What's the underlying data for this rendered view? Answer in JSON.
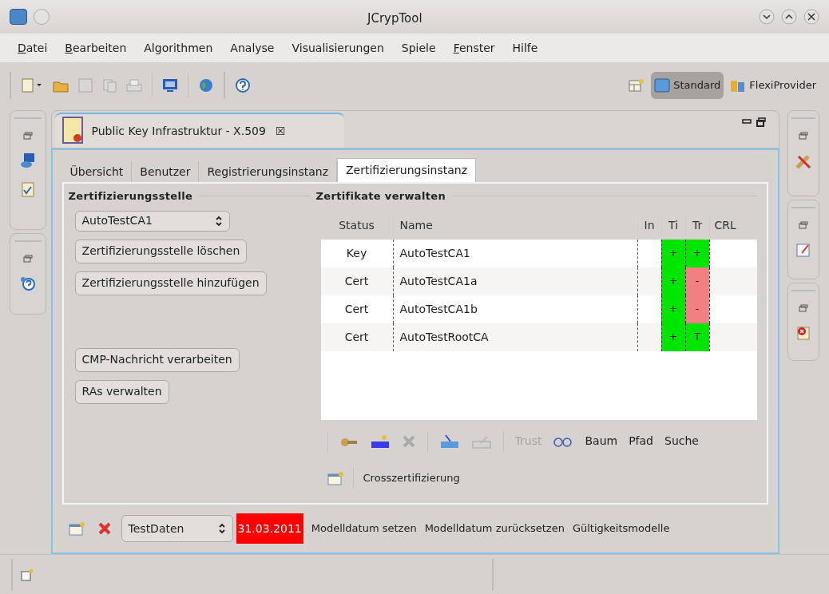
{
  "window": {
    "title": "JCrypTool"
  },
  "menu": [
    {
      "label": "Datei",
      "mnemonic": true
    },
    {
      "label": "Bearbeiten",
      "mnemonic": true
    },
    {
      "label": "Algorithmen",
      "mnemonic": false
    },
    {
      "label": "Analyse",
      "mnemonic": false
    },
    {
      "label": "Visualisierungen",
      "mnemonic": false
    },
    {
      "label": "Spiele",
      "mnemonic": false
    },
    {
      "label": "Fenster",
      "mnemonic": true
    },
    {
      "label": "Hilfe",
      "mnemonic": false
    }
  ],
  "perspectives": [
    {
      "label": "Standard",
      "selected": true
    },
    {
      "label": "FlexiProvider",
      "selected": false
    }
  ],
  "editor": {
    "title": "Public Key Infrastruktur - X.509",
    "close": "☒"
  },
  "tabs": [
    {
      "label": "Übersicht",
      "selected": false
    },
    {
      "label": "Benutzer",
      "selected": false
    },
    {
      "label": "Registrierungsinstanz",
      "selected": false
    },
    {
      "label": "Zertifizierungsinstanz",
      "selected": true
    }
  ],
  "ca_section": {
    "title": "Zertifizierungsstelle",
    "select": "AutoTestCA1",
    "buttons": [
      "Zertifizierungsstelle löschen",
      "Zertifizierungsstelle hinzufügen"
    ],
    "buttons_lower": [
      "CMP-Nachricht verarbeiten",
      "RAs verwalten"
    ]
  },
  "cert_section": {
    "title": "Zertifikate verwalten",
    "columns": [
      "Status",
      "Name",
      "In",
      "Ti",
      "Tr",
      "CRL"
    ],
    "rows": [
      {
        "status": "Key",
        "name": "AutoTestCA1",
        "ti": {
          "text": "+",
          "color": "#00e600"
        },
        "tr": {
          "text": "+",
          "color": "#00e600"
        }
      },
      {
        "status": "Cert",
        "name": "AutoTestCA1a",
        "ti": {
          "text": "+",
          "color": "#00e600"
        },
        "tr": {
          "text": "-",
          "color": "#f28080"
        }
      },
      {
        "status": "Cert",
        "name": "AutoTestCA1b",
        "ti": {
          "text": "+",
          "color": "#00e600"
        },
        "tr": {
          "text": "-",
          "color": "#f28080"
        }
      },
      {
        "status": "Cert",
        "name": "AutoTestRootCA",
        "ti": {
          "text": "+",
          "color": "#00e600"
        },
        "tr": {
          "text": "T",
          "color": "#00e600"
        }
      }
    ],
    "actions": [
      {
        "label": "Trust",
        "disabled": true
      },
      {
        "label": "Baum",
        "disabled": false
      },
      {
        "label": "Pfad",
        "disabled": false
      },
      {
        "label": "Suche",
        "disabled": false
      }
    ],
    "cross": "Crosszertifizierung"
  },
  "bottom": {
    "select": "TestDaten",
    "date": "31.03.2011",
    "links": [
      "Modelldatum setzen",
      "Modelldatum zurücksetzen",
      "Gültigkeitsmodelle"
    ]
  }
}
